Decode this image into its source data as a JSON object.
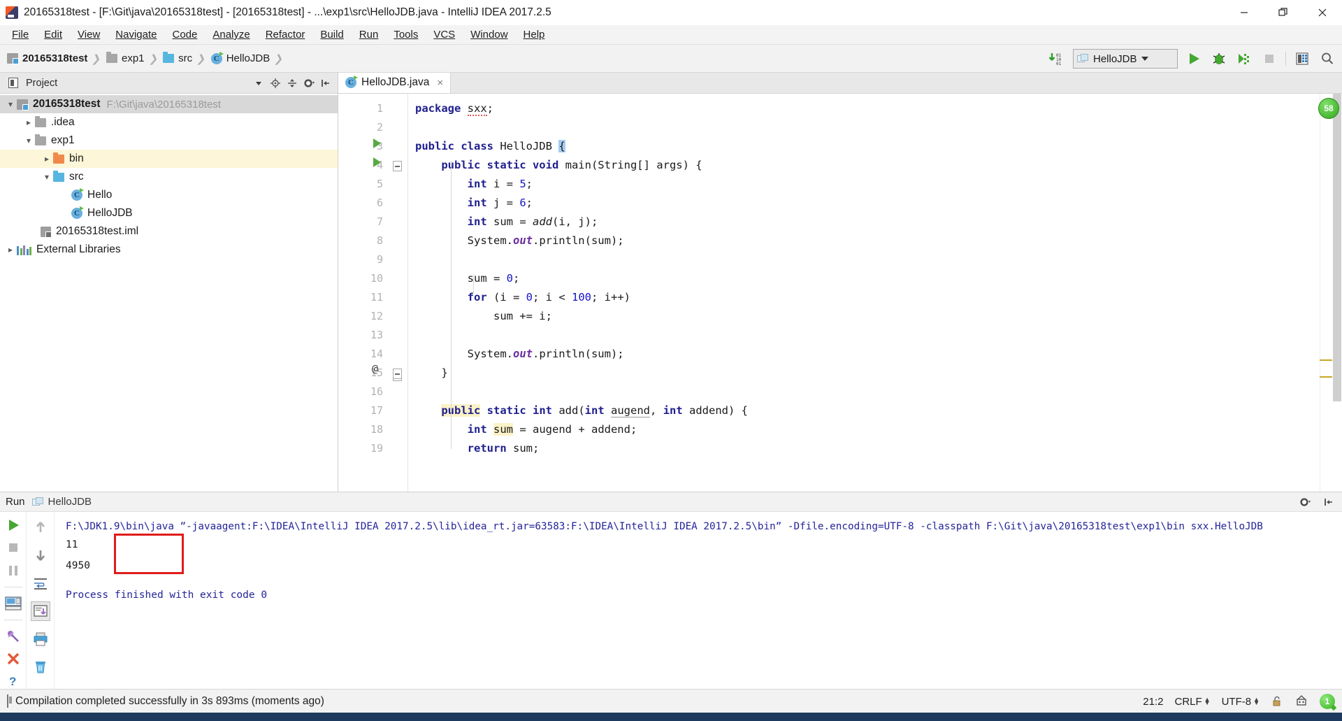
{
  "window": {
    "title": "20165318test - [F:\\Git\\java\\20165318test] - [20165318test] - ...\\exp1\\src\\HelloJDB.java - IntelliJ IDEA 2017.2.5",
    "minimize_label": "—",
    "maximize_label": "❐",
    "close_label": "✕",
    "app_icon": "intellij-idea-icon"
  },
  "menubar": {
    "items": [
      {
        "label": "File"
      },
      {
        "label": "Edit"
      },
      {
        "label": "View"
      },
      {
        "label": "Navigate"
      },
      {
        "label": "Code"
      },
      {
        "label": "Analyze"
      },
      {
        "label": "Refactor"
      },
      {
        "label": "Build"
      },
      {
        "label": "Run"
      },
      {
        "label": "Tools"
      },
      {
        "label": "VCS"
      },
      {
        "label": "Window"
      },
      {
        "label": "Help"
      }
    ]
  },
  "navbar": {
    "breadcrumbs": [
      {
        "label": "20165318test",
        "icon": "project-module-icon",
        "bold": true
      },
      {
        "label": "exp1",
        "icon": "folder-icon",
        "bold": false
      },
      {
        "label": "src",
        "icon": "source-folder-icon",
        "bold": false
      },
      {
        "label": "HelloJDB",
        "icon": "java-class-icon",
        "bold": false
      }
    ],
    "separator": "❯",
    "toolbar": {
      "compile_icon": "compile-binary-icon",
      "run_config_name": "HelloJDB",
      "run_config_icon": "application-config-icon",
      "run_label": "run-button",
      "debug_label": "debug-button",
      "coverage_label": "run-with-coverage-button",
      "stop_label": "stop-button",
      "db_label": "database-button",
      "search_label": "search-everywhere-button"
    }
  },
  "project_panel": {
    "header": {
      "title": "Project",
      "icons": [
        "project-view-icon",
        "chevron-down-icon",
        "locate-icon",
        "collapse-all-icon",
        "gear-icon",
        "hide-icon"
      ]
    },
    "tree": [
      {
        "label": "20165318test",
        "path": "F:\\Git\\java\\20165318test",
        "icon": "project-module-icon",
        "depth": 0,
        "arrow": "expanded",
        "bold": true,
        "selected": true
      },
      {
        "label": ".idea",
        "path": "",
        "icon": "folder-icon",
        "depth": 1,
        "arrow": "collapsed",
        "bold": false,
        "selected": false
      },
      {
        "label": "exp1",
        "path": "",
        "icon": "folder-icon",
        "depth": 1,
        "arrow": "expanded",
        "bold": false,
        "selected": false
      },
      {
        "label": "bin",
        "path": "",
        "icon": "excluded-folder-icon",
        "depth": 2,
        "arrow": "collapsed",
        "bold": false,
        "selected": false,
        "highlight": true
      },
      {
        "label": "src",
        "path": "",
        "icon": "source-folder-icon",
        "depth": 2,
        "arrow": "expanded",
        "bold": false,
        "selected": false
      },
      {
        "label": "Hello",
        "path": "",
        "icon": "java-class-icon",
        "depth": 3,
        "arrow": "none",
        "bold": false,
        "selected": false
      },
      {
        "label": "HelloJDB",
        "path": "",
        "icon": "java-class-icon",
        "depth": 3,
        "arrow": "none",
        "bold": false,
        "selected": false
      },
      {
        "label": "20165318test.iml",
        "path": "",
        "icon": "iml-file-icon",
        "depth": 2,
        "arrow": "none",
        "bold": false,
        "selected": false
      },
      {
        "label": "External Libraries",
        "path": "",
        "icon": "library-icon",
        "depth": 0,
        "arrow": "collapsed",
        "bold": false,
        "selected": false
      }
    ]
  },
  "editor": {
    "tabs": [
      {
        "label": "HelloJDB.java",
        "icon": "java-class-icon",
        "close": "×",
        "active": true
      }
    ],
    "inspection_badge": "58",
    "lines": [
      {
        "n": 1,
        "run": false,
        "at": false,
        "fold": "none"
      },
      {
        "n": 2,
        "run": false,
        "at": false,
        "fold": "none"
      },
      {
        "n": 3,
        "run": true,
        "at": false,
        "fold": "none"
      },
      {
        "n": 4,
        "run": true,
        "at": false,
        "fold": "start"
      },
      {
        "n": 5,
        "run": false,
        "at": false,
        "fold": "none"
      },
      {
        "n": 6,
        "run": false,
        "at": false,
        "fold": "none"
      },
      {
        "n": 7,
        "run": false,
        "at": false,
        "fold": "none"
      },
      {
        "n": 8,
        "run": false,
        "at": false,
        "fold": "none"
      },
      {
        "n": 9,
        "run": false,
        "at": false,
        "fold": "none"
      },
      {
        "n": 10,
        "run": false,
        "at": false,
        "fold": "none"
      },
      {
        "n": 11,
        "run": false,
        "at": false,
        "fold": "none"
      },
      {
        "n": 12,
        "run": false,
        "at": false,
        "fold": "none"
      },
      {
        "n": 13,
        "run": false,
        "at": false,
        "fold": "none"
      },
      {
        "n": 14,
        "run": false,
        "at": false,
        "fold": "none"
      },
      {
        "n": 15,
        "run": false,
        "at": false,
        "fold": "end"
      },
      {
        "n": 16,
        "run": false,
        "at": false,
        "fold": "none"
      },
      {
        "n": 17,
        "run": false,
        "at": true,
        "fold": "start"
      },
      {
        "n": 18,
        "run": false,
        "at": false,
        "fold": "none"
      },
      {
        "n": 19,
        "run": false,
        "at": false,
        "fold": "none"
      }
    ],
    "code_text": [
      "package sxx;",
      "",
      "public class HelloJDB {",
      "    public static void main(String[] args) {",
      "        int i = 5;",
      "        int j = 6;",
      "        int sum = add(i, j);",
      "        System.out.println(sum);",
      "",
      "        sum = 0;",
      "        for (i = 0; i < 100; i++)",
      "            sum += i;",
      "",
      "        System.out.println(sum);",
      "    }",
      "",
      "    public static int add(int augend, int addend) {",
      "        int sum = augend + addend;",
      "        return sum;"
    ]
  },
  "run_window": {
    "title": "Run",
    "tab_label": "HelloJDB",
    "tab_icon": "run-config-icon",
    "header_icons": [
      "gear-icon",
      "hide-icon"
    ],
    "left_toolbar": [
      "rerun-button",
      "stop-button",
      "pause-button",
      "layout-button",
      "pin-tab-button",
      "close-button",
      "help-button"
    ],
    "left_toolbar2": [
      "up-stack-button",
      "down-stack-button",
      "soft-wrap-button",
      "scroll-to-end-button",
      "print-button",
      "clear-all-button"
    ],
    "console": {
      "command": "F:\\JDK1.9\\bin\\java ˮ-javaagent:F:\\IDEA\\IntelliJ IDEA 2017.2.5\\lib\\idea_rt.jar=63583:F:\\IDEA\\IntelliJ IDEA 2017.2.5\\binˮ -Dfile.encoding=UTF-8 -classpath F:\\Git\\java\\20165318test\\exp1\\bin sxx.HelloJDB",
      "output_lines": [
        "11",
        "4950"
      ],
      "exit_message": "Process finished with exit code 0",
      "annotation_color": "#e01b1b"
    }
  },
  "statusbar": {
    "message": "Compilation completed successfully in 3s 893ms (moments ago)",
    "message_icon": "build-icon",
    "caret_position": "21:2",
    "line_separator": "CRLF",
    "encoding": "UTF-8",
    "lock_icon": "unlocked-icon",
    "inspector_icon": "inspector-icon",
    "event_count": "1"
  }
}
